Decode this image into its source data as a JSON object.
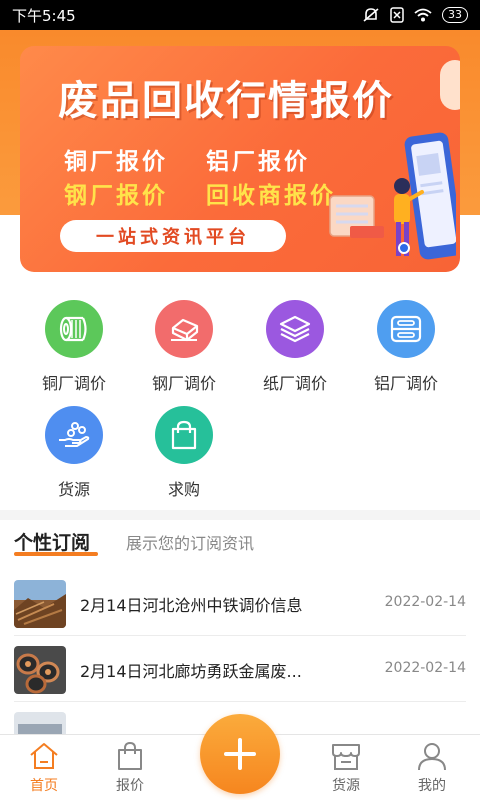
{
  "status": {
    "time": "下午5:45",
    "battery": "33"
  },
  "banner": {
    "title": "废品回收行情报价",
    "lines": [
      "铜厂报价",
      "铝厂报价",
      "钢厂报价",
      "回收商报价"
    ],
    "pill": "一站式资讯平台"
  },
  "categories": [
    {
      "label": "铜厂调价",
      "icon": "copper-coil-icon",
      "color": "#5cc85a"
    },
    {
      "label": "钢厂调价",
      "icon": "steel-bar-icon",
      "color": "#f26c6c"
    },
    {
      "label": "纸厂调价",
      "icon": "paper-layers-icon",
      "color": "#9b58e0"
    },
    {
      "label": "铝厂调价",
      "icon": "aluminum-icon",
      "color": "#4f9ef0"
    },
    {
      "label": "货源",
      "icon": "hand-supply-icon",
      "color": "#4f8ef0"
    },
    {
      "label": "求购",
      "icon": "shopping-bag-icon",
      "color": "#26c09a"
    }
  ],
  "subscription": {
    "title": "个性订阅",
    "desc": "展示您的订阅资讯",
    "items": [
      {
        "title": "2月14日河北沧州中铁调价信息",
        "date": "2022-02-14"
      },
      {
        "title": "2月14日河北廊坊勇跃金属废...",
        "date": "2022-02-14"
      }
    ]
  },
  "tabs": [
    {
      "label": "首页",
      "icon": "home-icon",
      "active": true
    },
    {
      "label": "报价",
      "icon": "bag-icon",
      "active": false
    },
    {
      "label": "货源",
      "icon": "store-icon",
      "active": false
    },
    {
      "label": "我的",
      "icon": "user-icon",
      "active": false
    }
  ],
  "accent_color": "#f47d21"
}
